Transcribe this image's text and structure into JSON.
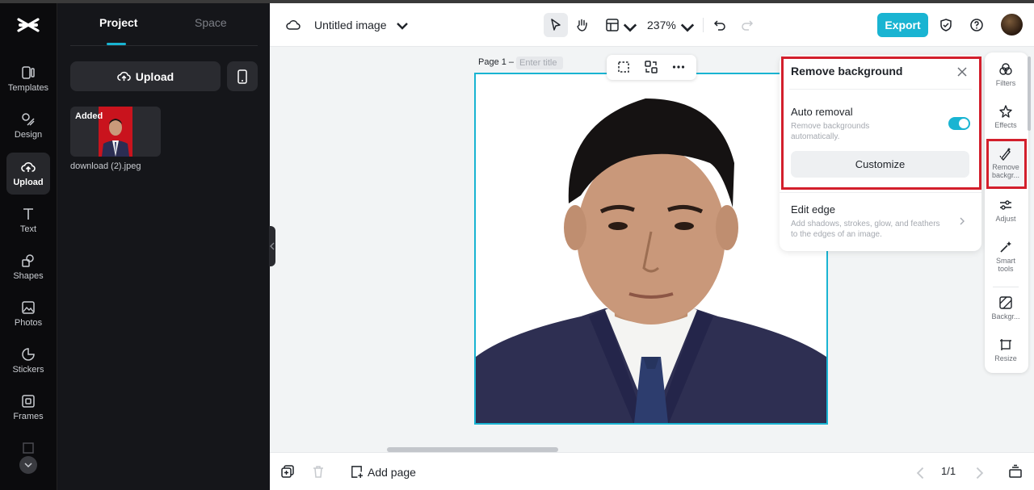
{
  "app": {
    "doc_title": "Untitled image",
    "zoom": "237%",
    "export_label": "Export"
  },
  "left_rail": {
    "items": [
      {
        "label": "Templates",
        "icon": "templates-icon"
      },
      {
        "label": "Design",
        "icon": "design-icon"
      },
      {
        "label": "Upload",
        "icon": "upload-cloud-icon",
        "active": true
      },
      {
        "label": "Text",
        "icon": "text-icon"
      },
      {
        "label": "Shapes",
        "icon": "shapes-icon"
      },
      {
        "label": "Photos",
        "icon": "photos-icon"
      },
      {
        "label": "Stickers",
        "icon": "stickers-icon"
      },
      {
        "label": "Frames",
        "icon": "frames-icon"
      }
    ]
  },
  "panel": {
    "tabs": [
      {
        "label": "Project",
        "active": true
      },
      {
        "label": "Space",
        "active": false
      }
    ],
    "upload_label": "Upload",
    "asset": {
      "badge": "Added",
      "filename": "download (2).jpeg"
    }
  },
  "canvas": {
    "page_label": "Page 1 –",
    "title_placeholder": "Enter title"
  },
  "bottom": {
    "add_page_label": "Add page",
    "page_count": "1/1"
  },
  "remove_bg": {
    "title": "Remove background",
    "auto_title": "Auto removal",
    "auto_desc": "Remove backgrounds automatically.",
    "auto_enabled": true,
    "customize_label": "Customize",
    "edge_title": "Edit edge",
    "edge_desc": "Add shadows, strokes, glow, and feathers to the edges of an image."
  },
  "right_rail": {
    "items": [
      {
        "label": "Filters",
        "icon": "filters-icon"
      },
      {
        "label": "Effects",
        "icon": "effects-icon"
      },
      {
        "label": "Remove backgr...",
        "icon": "remove-background-icon",
        "active": true
      },
      {
        "label": "Adjust",
        "icon": "adjust-icon"
      },
      {
        "label": "Smart tools",
        "icon": "smart-tools-icon"
      },
      {
        "label": "Backgr...",
        "icon": "background-icon"
      },
      {
        "label": "Resize",
        "icon": "resize-icon"
      }
    ]
  },
  "colors": {
    "accent": "#19b4d2",
    "highlight_red": "#d31f2c",
    "rail_bg": "#0b0b0d",
    "panel_bg": "#15161a"
  }
}
